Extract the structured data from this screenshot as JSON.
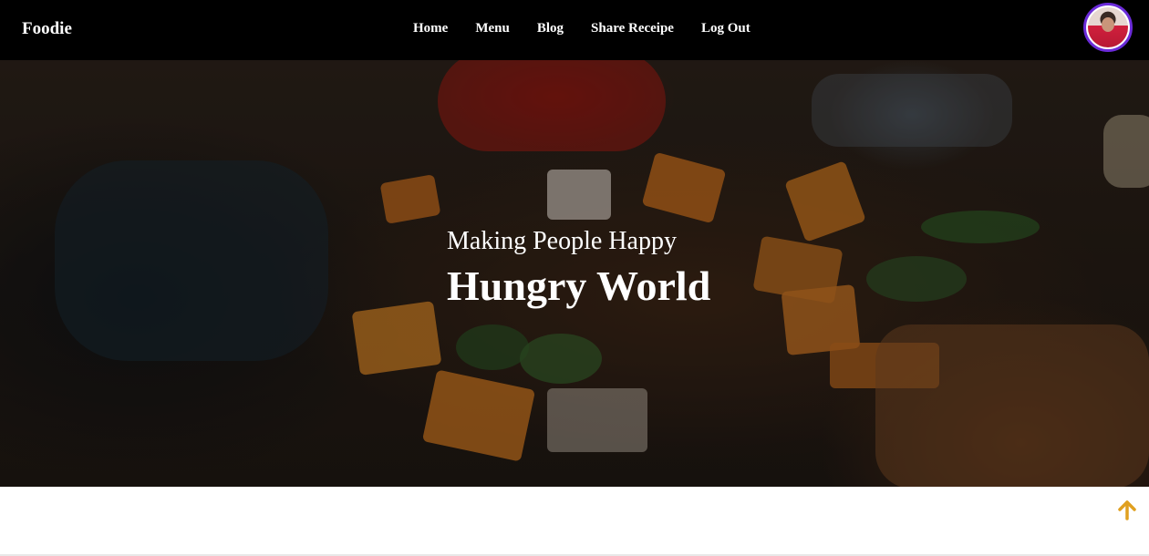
{
  "navbar": {
    "brand": "Foodie",
    "links": [
      "Home",
      "Menu",
      "Blog",
      "Share Receipe",
      "Log Out"
    ],
    "avatar_ring_color": "#6b2bd9"
  },
  "hero": {
    "subtitle": "Making People Happy",
    "title": "Hungry World"
  },
  "scroll_top": {
    "icon": "arrow-up-icon",
    "color": "#e0a020"
  }
}
